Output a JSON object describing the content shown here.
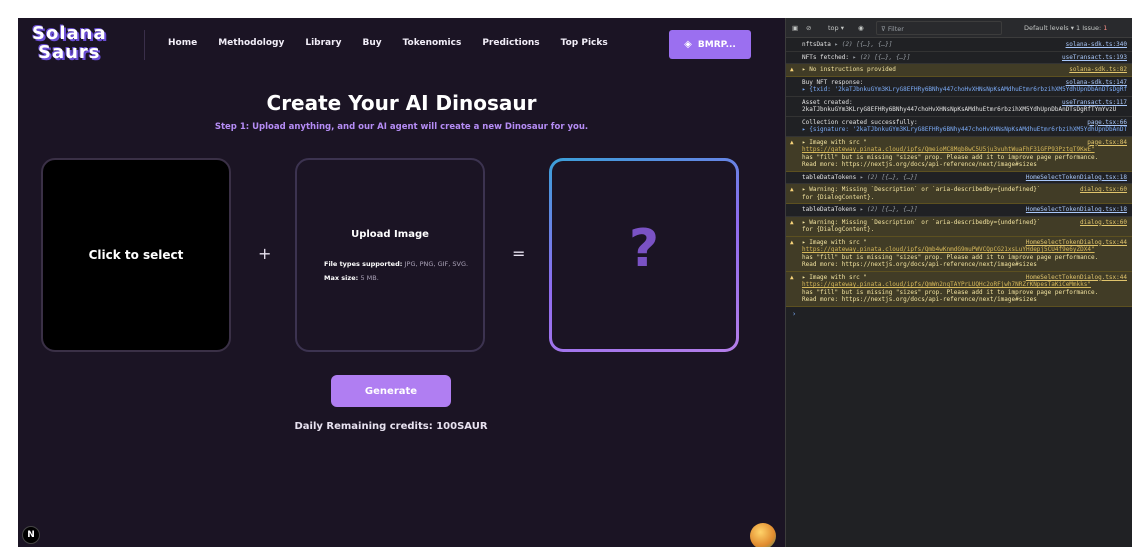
{
  "app": {
    "logo_line1": "Solana",
    "logo_line2": "Saurs",
    "nav": [
      "Home",
      "Methodology",
      "Library",
      "Buy",
      "Tokenomics",
      "Predictions",
      "Top Picks"
    ],
    "wallet_label": "BMRP...",
    "title": "Create Your AI Dinosaur",
    "subtitle": "Step 1: Upload anything, and our AI agent will create a new Dinosaur for you.",
    "select_label": "Click to select",
    "plus": "+",
    "upload_heading": "Upload Image",
    "filetypes_label": "File types supported:",
    "filetypes_value": "JPG, PNG, GIF, SVG.",
    "maxsize_label": "Max size:",
    "maxsize_value": "5 MB.",
    "equals": "=",
    "result_placeholder": "?",
    "generate_label": "Generate",
    "credits_text": "Daily Remaining credits: 100SAUR",
    "n_badge": "N"
  },
  "devtools": {
    "context": "top ▾",
    "filter_placeholder": "Filter",
    "levels": "Default levels ▾",
    "issues": "1 Issue:",
    "issue_count": "1",
    "logs": [
      {
        "type": "log",
        "text": "nftsData",
        "obj": "▸ (2) [{…}, {…}]",
        "src": "solana-sdk.ts:340"
      },
      {
        "type": "log",
        "text": "NFTs fetched:",
        "obj": "▸ (2) [{…}, {…}]",
        "src": "useTransact.ts:193"
      },
      {
        "type": "warn",
        "text": "▸ No instructions provided",
        "src": "solana-sdk.ts:82"
      },
      {
        "type": "log",
        "text": "Buy NFT response:",
        "src": "solana-sdk.ts:147",
        "line2": "▸ {txid: '2kaTJbnkuGYm3KLryG8EFHRy6BNhy447choHvXHNsNpKsAMdhuEtmr6rbzihXM5YdhUpnDbAnDTsDgRfTYmYvzU'}"
      },
      {
        "type": "log",
        "text": "Asset created:",
        "src": "useTransact.ts:117",
        "line2": "2kaTJbnkuGYm3KLryG8EFHRy6BNhy447choHvXHNsNpKsAMdhuEtmr6rbzihXM5YdhUpnDbAnDTsDgRfTYmYvzU"
      },
      {
        "type": "log",
        "text": "Collection created successfully:",
        "src": "page.tsx:66",
        "line2": "▸ {signature: '2kaTJbnkuGYm3KLryG8EFHRy6BNhy447choHvXHNsNpKsAMdhuEtmr6rbzihXM5YdhUpnDbAnDTsDgRfTYmYvzU', success: true}"
      },
      {
        "type": "warn",
        "text": "▸ Image with src \"",
        "src": "page.tsx:84",
        "line2": "https://gateway.pinata.cloud/ipfs/QmeioMC8Mqb8wC5U5ju3vuhtWuaFhF31GFP93PztqT9KwE\"",
        "line3": "has \"fill\" but is missing \"sizes\" prop. Please add it to improve page performance.",
        "line4": "Read more: https://nextjs.org/docs/api-reference/next/image#sizes"
      },
      {
        "type": "log",
        "text": "tableDataTokens",
        "obj": "▸ (2) [{…}, {…}]",
        "src": "HomeSelectTokenDialog.tsx:18"
      },
      {
        "type": "warn",
        "text": "▸ Warning: Missing `Description` or `aria-describedby={undefined}`",
        "src": "dialog.tsx:60",
        "line2": "for {DialogContent}."
      },
      {
        "type": "log",
        "text": "tableDataTokens",
        "obj": "▸ (2) [{…}, {…}]",
        "src": "HomeSelectTokenDialog.tsx:18"
      },
      {
        "type": "warn",
        "text": "▸ Warning: Missing `Description` or `aria-describedby={undefined}`",
        "src": "dialog.tsx:60",
        "line2": "for {DialogContent}."
      },
      {
        "type": "warn",
        "text": "▸ Image with src \"",
        "src": "HomeSelectTokenDialog.tsx:44",
        "line2": "https://gateway.pinata.cloud/ipfs/Qmb4wKnmdG9muPWVCQpCG21xsLuYHdepj5CU4f9e6yZDX4\"",
        "line3": "has \"fill\" but is missing \"sizes\" prop. Please add it to improve page performance.",
        "line4": "Read more: https://nextjs.org/docs/api-reference/next/image#sizes"
      },
      {
        "type": "warn",
        "text": "▸ Image with src \"",
        "src": "HomeSelectTokenDialog.tsx:44",
        "line2": "https://gateway.pinata.cloud/ipfs/QmWn2nqTAYPrLUQHc2oRFjwh7NRZrKNpesTaKiCeMmkks\"",
        "line3": "has \"fill\" but is missing \"sizes\" prop. Please add it to improve page performance.",
        "line4": "Read more: https://nextjs.org/docs/api-reference/next/image#sizes"
      }
    ],
    "prompt": "›"
  }
}
